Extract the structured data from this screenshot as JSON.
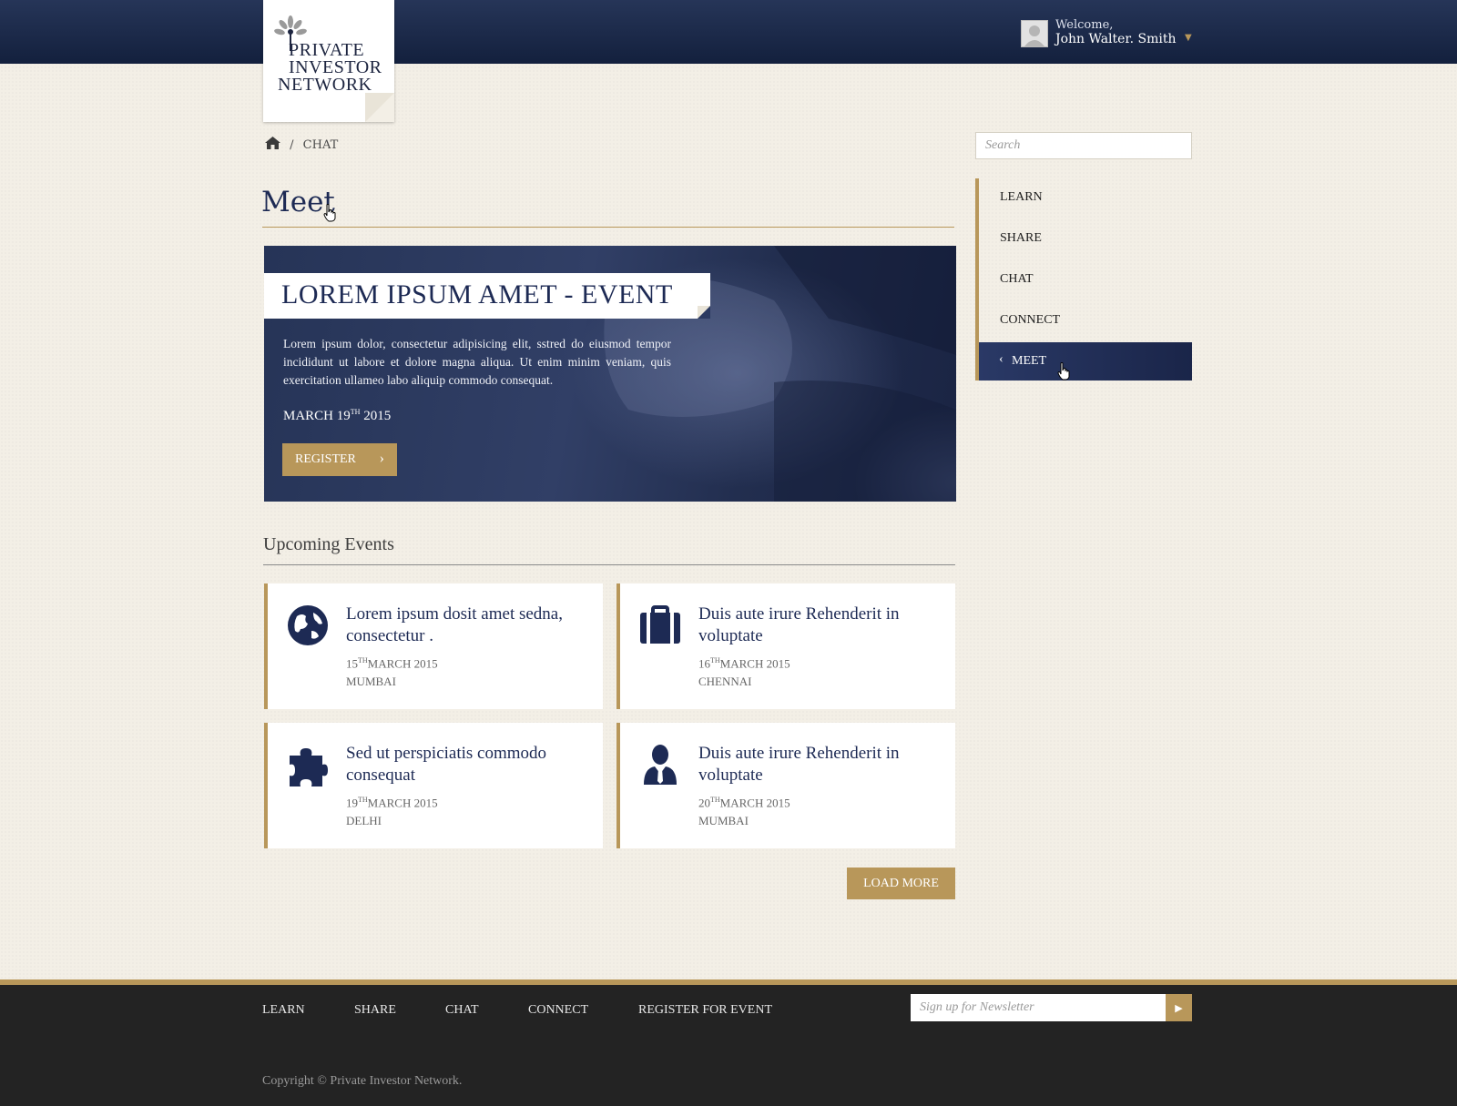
{
  "header": {
    "logo_lines": [
      "PRIVATE",
      "INVESTOR",
      "NETWORK"
    ],
    "welcome": "Welcome,",
    "user_name": "John Walter. Smith"
  },
  "breadcrumb": {
    "current": "CHAT"
  },
  "page_title": "Meet",
  "hero": {
    "title": "LOREM IPSUM AMET - EVENT",
    "description": "Lorem ipsum dolor, consectetur adipisicing elit, sstred do eiusmod tempor incididunt ut labore et dolore magna aliqua. Ut enim minim veniam, quis exercitation ullameo labo aliquip commodo consequat.",
    "date_month": "MARCH 19",
    "date_suffix": "TH",
    "date_year": " 2015",
    "register_label": "REGISTER"
  },
  "upcoming": {
    "title": "Upcoming Events",
    "events": [
      {
        "icon": "globe-icon",
        "title": "Lorem ipsum dosit amet sedna, consectetur .",
        "day": "15",
        "suffix": "TH",
        "month_year": "MARCH 2015",
        "city": "MUMBAI"
      },
      {
        "icon": "briefcase-icon",
        "title": "Duis aute irure Rehenderit in voluptate",
        "day": "16",
        "suffix": "TH",
        "month_year": "MARCH 2015",
        "city": "CHENNAI"
      },
      {
        "icon": "puzzle-icon",
        "title": "Sed ut perspiciatis commodo consequat",
        "day": "19",
        "suffix": "TH",
        "month_year": "MARCH 2015",
        "city": "DELHI"
      },
      {
        "icon": "person-icon",
        "title": "Duis aute irure Rehenderit in voluptate",
        "day": "20",
        "suffix": "TH",
        "month_year": "MARCH 2015",
        "city": "MUMBAI"
      }
    ],
    "load_more_label": "LOAD MORE"
  },
  "sidebar": {
    "search_placeholder": "Search",
    "items": [
      {
        "label": "LEARN"
      },
      {
        "label": "SHARE"
      },
      {
        "label": "CHAT"
      },
      {
        "label": "CONNECT"
      },
      {
        "label": "MEET",
        "active": true
      }
    ]
  },
  "footer": {
    "links": [
      "LEARN",
      "SHARE",
      "CHAT",
      "CONNECT",
      "REGISTER FOR EVENT"
    ],
    "newsletter_placeholder": "Sign up for Newsletter",
    "copyright": "Copyright © Private Investor Network."
  },
  "colors": {
    "navy": "#1d2a54",
    "gold": "#b8975a",
    "background": "#f3efe6",
    "footer": "#232323"
  }
}
